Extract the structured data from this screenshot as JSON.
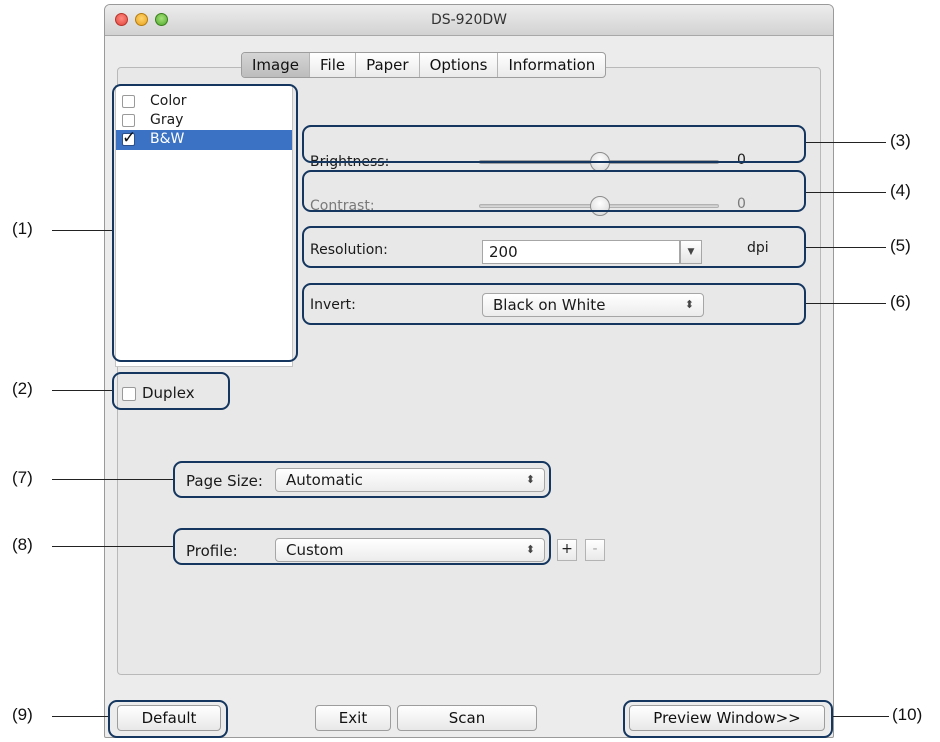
{
  "window": {
    "title": "DS-920DW"
  },
  "tabs": [
    {
      "label": "Image",
      "active": true
    },
    {
      "label": "File"
    },
    {
      "label": "Paper"
    },
    {
      "label": "Options"
    },
    {
      "label": "Information"
    }
  ],
  "color_modes": [
    {
      "label": "Color",
      "checked": false
    },
    {
      "label": "Gray",
      "checked": false
    },
    {
      "label": "B&W",
      "checked": true,
      "selected": true
    }
  ],
  "brightness": {
    "label": "Brightness:",
    "value": "0",
    "level_fraction": 0.5
  },
  "contrast": {
    "label": "Contrast:",
    "value": "0",
    "level_fraction": 0.5,
    "enabled": false
  },
  "resolution": {
    "label": "Resolution:",
    "value": "200",
    "unit": "dpi"
  },
  "invert": {
    "label": "Invert:",
    "value": "Black on White"
  },
  "duplex": {
    "label": "Duplex",
    "checked": false
  },
  "page_size": {
    "label": "Page Size:",
    "value": "Automatic"
  },
  "profile": {
    "label": "Profile:",
    "value": "Custom",
    "add_label": "+",
    "remove_label": "-"
  },
  "buttons": {
    "default": "Default",
    "exit": "Exit",
    "scan": "Scan",
    "preview": "Preview Window>>"
  },
  "callouts": {
    "c1": "(1)",
    "c2": "(2)",
    "c3": "(3)",
    "c4": "(4)",
    "c5": "(5)",
    "c6": "(6)",
    "c7": "(7)",
    "c8": "(8)",
    "c9": "(9)",
    "c10": "(10)"
  },
  "colors": {
    "selection": "#3c72c4",
    "callout_border": "#14365f"
  }
}
